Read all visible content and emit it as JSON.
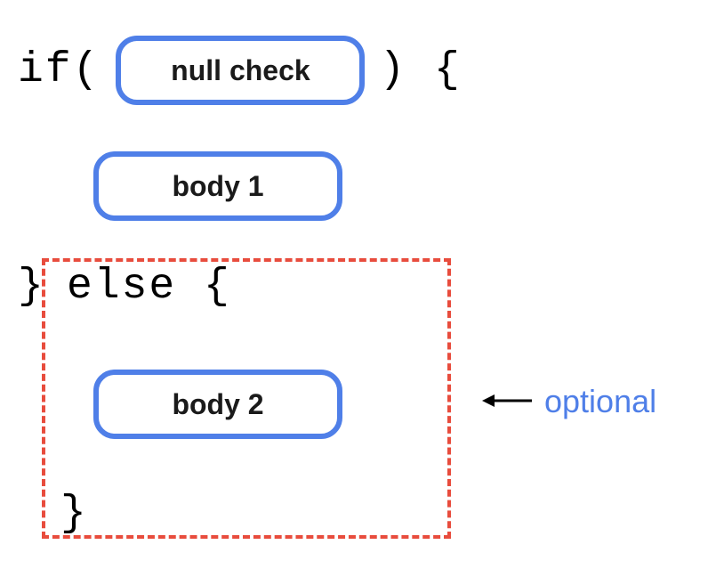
{
  "code": {
    "if_keyword": "if(",
    "close_paren_brace": ") {",
    "close_brace": "}",
    "else_clause": "else {",
    "final_close_brace": "}"
  },
  "pills": {
    "null_check": "null check",
    "body1": "body 1",
    "body2": "body 2"
  },
  "annotation": {
    "optional": "optional"
  }
}
